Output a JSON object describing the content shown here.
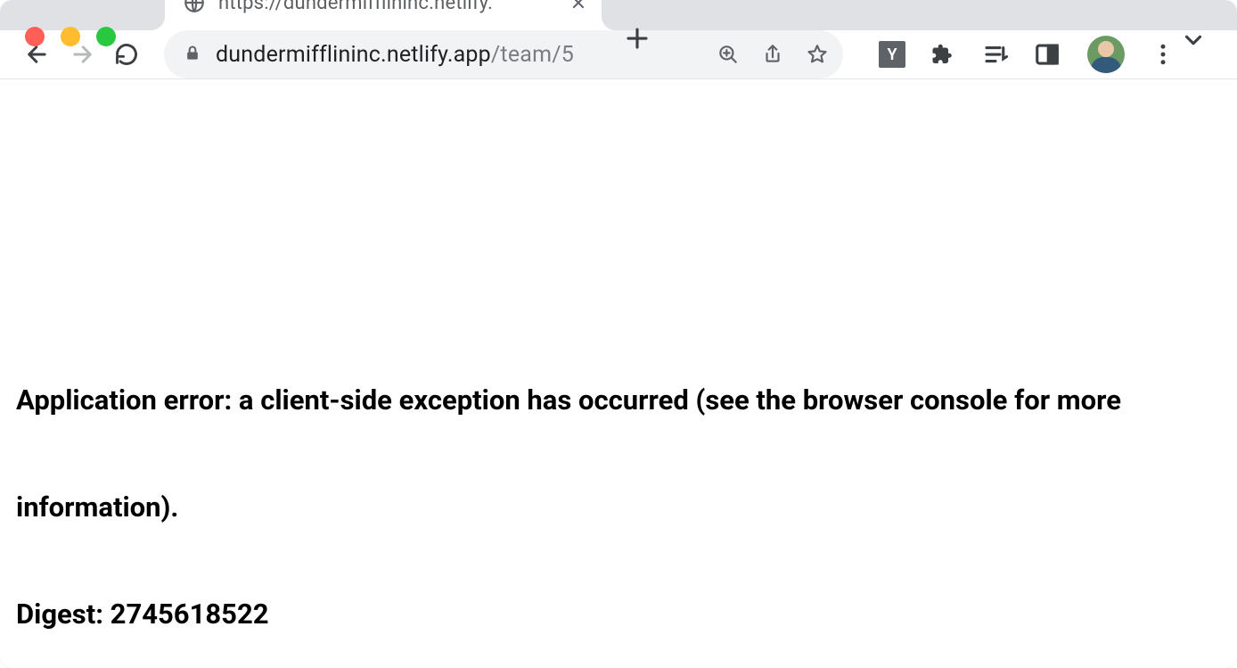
{
  "chrome": {
    "tab": {
      "title": "https://dundermifflininc.netlify."
    },
    "url": {
      "host": "dundermifflininc.netlify.app",
      "path": "/team/5"
    },
    "extensions": {
      "y_label": "Y"
    }
  },
  "page": {
    "error_message": "Application error: a client-side exception has occurred (see the browser console for more information).",
    "digest_label": "Digest: ",
    "digest_value": "2745618522"
  }
}
